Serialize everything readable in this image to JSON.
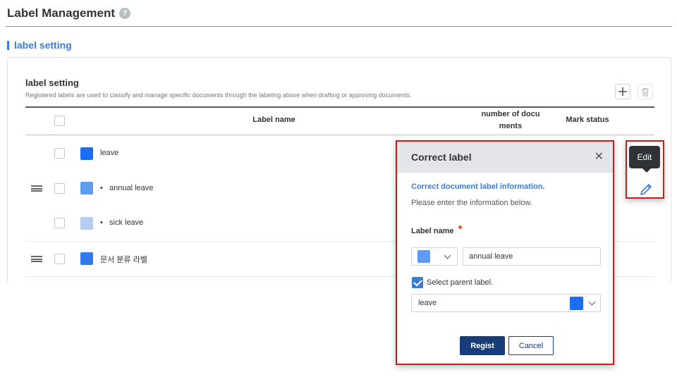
{
  "page": {
    "title": "Label Management",
    "help_icon": "question-circle-icon"
  },
  "section": {
    "title": "label setting"
  },
  "card": {
    "title": "label setting",
    "description": "Registered labels are used to classify and manage specific documents through the labeling above when drafting or approving documents.",
    "add_icon": "plus-icon",
    "delete_icon": "trash-icon"
  },
  "table": {
    "headers": {
      "name": "Label name",
      "docs_line1": "number of docu",
      "docs_line2": "ments",
      "status": "Mark status"
    },
    "rows": [
      {
        "label": "leave",
        "color": "#1a6ef5",
        "bullet": "",
        "draggable": false
      },
      {
        "label": "annual leave",
        "color": "#5e9bf2",
        "bullet": "•",
        "draggable": true
      },
      {
        "label": "sick leave",
        "color": "#b5cdf3",
        "bullet": "•",
        "draggable": false
      },
      {
        "label": "문서 분류 라벨",
        "color": "#2f7af3",
        "bullet": "",
        "draggable": true
      }
    ]
  },
  "dialog": {
    "title": "Correct label",
    "close_icon": "close-icon",
    "subtitle": "Correct document label information.",
    "info": "Please enter the information below.",
    "field_label": "Label name",
    "color_value": "#5e9bf2",
    "name_value": "annual leave",
    "parent_checkbox_label": "Select parent label.",
    "parent_checked": true,
    "parent_value": "leave",
    "parent_color": "#1a6ef5",
    "regist_label": "Regist",
    "cancel_label": "Cancel"
  },
  "edit_action": {
    "tooltip": "Edit",
    "icon": "pencil-icon"
  },
  "colors": {
    "accent": "#3a7bd5",
    "primary_button": "#163d7a",
    "highlight": "#d11a1a"
  }
}
